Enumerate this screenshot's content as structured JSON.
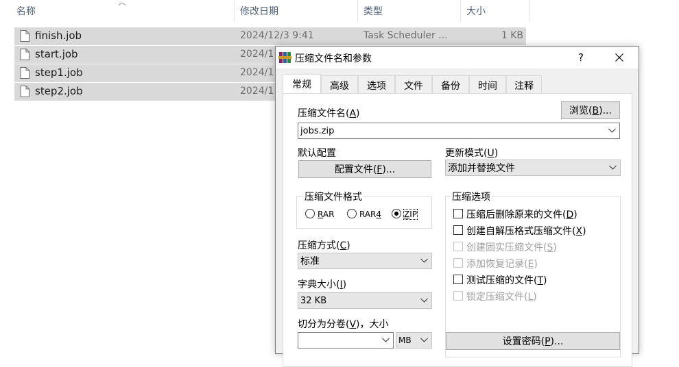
{
  "explorer": {
    "columns": {
      "name": "名称",
      "modified": "修改日期",
      "type": "类型",
      "size": "大小"
    },
    "files": [
      {
        "name": "finish.job",
        "date": "2024/12/3 9:41",
        "type": "Task Scheduler ...",
        "size": "1 KB"
      },
      {
        "name": "start.job",
        "date": "2024/1",
        "type": "",
        "size": ""
      },
      {
        "name": "step1.job",
        "date": "2024/1",
        "type": "",
        "size": ""
      },
      {
        "name": "step2.job",
        "date": "2024/1",
        "type": "",
        "size": ""
      }
    ]
  },
  "dialog": {
    "title": "压缩文件名和参数",
    "help": "?",
    "tabs": [
      "常规",
      "高级",
      "选项",
      "文件",
      "备份",
      "时间",
      "注释"
    ],
    "archive_name": {
      "label": "压缩文件名",
      "key": "A",
      "value": "jobs.zip"
    },
    "browse": {
      "label": "浏览",
      "key": "B",
      "suffix": "..."
    },
    "default_profile": {
      "label": "默认配置",
      "button": "配置文件",
      "key": "F",
      "suffix": "..."
    },
    "update_mode": {
      "label": "更新模式",
      "key": "U",
      "value": "添加并替换文件"
    },
    "format": {
      "title": "压缩文件格式",
      "options": [
        {
          "label": "RAR",
          "key": "R",
          "selected": false
        },
        {
          "label": "RAR4",
          "key": "4",
          "selected": false
        },
        {
          "label": "ZIP",
          "key": "Z",
          "selected": true
        }
      ]
    },
    "options": {
      "title": "压缩选项",
      "items": [
        {
          "label": "压缩后删除原来的文件",
          "key": "D",
          "checked": false,
          "enabled": true
        },
        {
          "label": "创建自解压格式压缩文件",
          "key": "X",
          "checked": false,
          "enabled": true
        },
        {
          "label": "创建固实压缩文件",
          "key": "S",
          "checked": false,
          "enabled": false
        },
        {
          "label": "添加恢复记录",
          "key": "E",
          "checked": false,
          "enabled": false
        },
        {
          "label": "测试压缩的文件",
          "key": "T",
          "checked": false,
          "enabled": true
        },
        {
          "label": "锁定压缩文件",
          "key": "L",
          "checked": false,
          "enabled": false
        }
      ]
    },
    "method": {
      "label": "压缩方式",
      "key": "C",
      "value": "标准"
    },
    "dictionary": {
      "label": "字典大小",
      "key": "I",
      "value": "32 KB"
    },
    "split": {
      "label": "切分为分卷",
      "key": "V",
      "suffix": "，大小",
      "value": "",
      "unit": "MB"
    },
    "password": {
      "label": "设置密码",
      "key": "P",
      "suffix": "..."
    }
  }
}
